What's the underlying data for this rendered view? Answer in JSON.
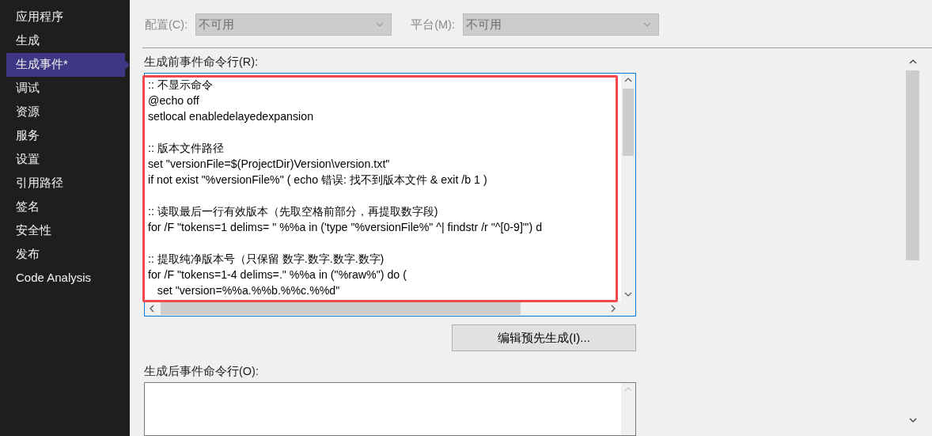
{
  "sidebar": {
    "items": [
      {
        "label": "应用程序",
        "selected": false
      },
      {
        "label": "生成",
        "selected": false
      },
      {
        "label": "生成事件*",
        "selected": true
      },
      {
        "label": "调试",
        "selected": false
      },
      {
        "label": "资源",
        "selected": false
      },
      {
        "label": "服务",
        "selected": false
      },
      {
        "label": "设置",
        "selected": false
      },
      {
        "label": "引用路径",
        "selected": false
      },
      {
        "label": "签名",
        "selected": false
      },
      {
        "label": "安全性",
        "selected": false
      },
      {
        "label": "发布",
        "selected": false
      },
      {
        "label": "Code Analysis",
        "selected": false
      }
    ]
  },
  "selectors": [
    {
      "label": "配置(C):",
      "value": "不可用",
      "disabled": true
    },
    {
      "label": "平台(M):",
      "value": "不可用",
      "disabled": true
    }
  ],
  "pre_build": {
    "label": "生成前事件命令行(R):",
    "highlighted": true,
    "blocks": [
      [
        ":: 不显示命令",
        "@echo off",
        "setlocal enabledelayedexpansion"
      ],
      [
        ":: 版本文件路径",
        "set \"versionFile=$(ProjectDir)Version\\version.txt\"",
        "if not exist \"%versionFile%\" ( echo 错误: 找不到版本文件 & exit /b 1 )"
      ],
      [
        ":: 读取最后一行有效版本（先取空格前部分，再提取数字段)",
        "for /F \"tokens=1 delims= \" %%a in ('type \"%versionFile%\" ^| findstr /r \"^[0-9]\"') d"
      ],
      [
        ":: 提取纯净版本号（只保留 数字.数字.数字.数字)",
        "for /F \"tokens=1-4 delims=.\" %%a in (\"%raw%\") do (",
        "   set \"version=%%a.%%b.%%c.%%d\""
      ]
    ]
  },
  "edit_button": "编辑预先生成(I)...",
  "post_build": {
    "label": "生成后事件命令行(O):"
  }
}
